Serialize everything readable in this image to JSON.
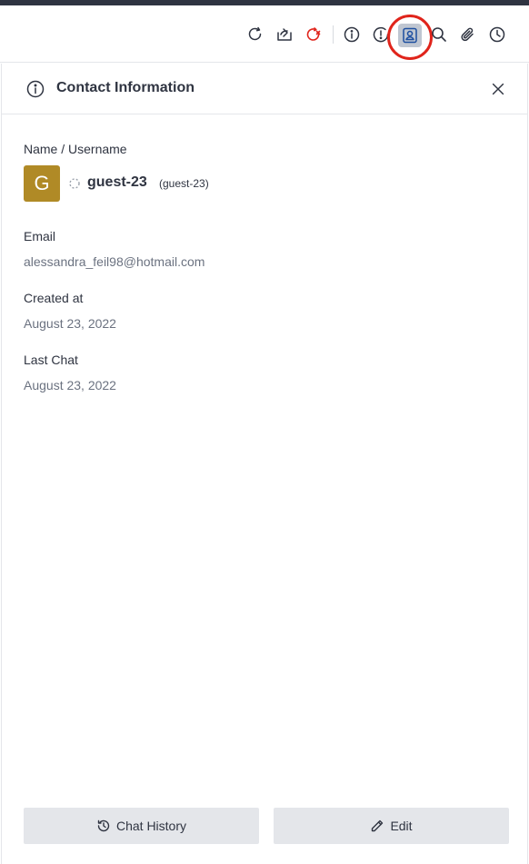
{
  "toolbar": {
    "icons": [
      "forward-icon",
      "transfer-icon",
      "close-chat-icon",
      "info-icon",
      "alert-icon",
      "contact-icon",
      "search-icon",
      "attachment-icon",
      "history-icon"
    ],
    "colors": {
      "close_chat": "#e0241b",
      "active_bg": "#bfc6d1",
      "highlight_ring": "#e0241b"
    }
  },
  "panel": {
    "title": "Contact Information",
    "name_label": "Name / Username",
    "avatar_letter": "G",
    "avatar_color": "#b08a26",
    "display_name": "guest-23",
    "username": "(guest-23)",
    "email_label": "Email",
    "email_value": "alessandra_feil98@hotmail.com",
    "created_label": "Created at",
    "created_value": "August 23, 2022",
    "last_chat_label": "Last Chat",
    "last_chat_value": "August 23, 2022"
  },
  "buttons": {
    "chat_history": "Chat History",
    "edit": "Edit"
  }
}
